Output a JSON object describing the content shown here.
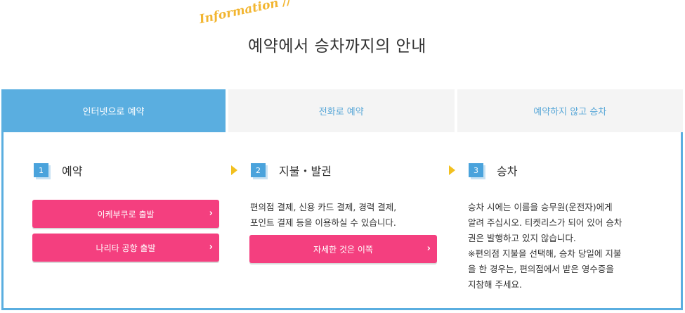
{
  "heading": {
    "decoration": "Information //",
    "title": "예약에서 승차까지의 안내"
  },
  "tabs": [
    {
      "label": "인터넷으로 예약",
      "active": true
    },
    {
      "label": "전화로 예약",
      "active": false
    },
    {
      "label": "예약하지 않고 승차",
      "active": false
    }
  ],
  "steps": [
    {
      "number": "1",
      "title": "예약",
      "buttons": [
        {
          "label": "이케부쿠로 출발",
          "icon": "chevron-right-icon"
        },
        {
          "label": "나리타 공항 출발",
          "icon": "chevron-right-icon"
        }
      ]
    },
    {
      "number": "2",
      "title": "지불・발권",
      "description_lines": [
        "편의점 결제, 신용 카드 결제, 경력 결제,",
        "포인트 결제 등을 이용하실 수 있습니다."
      ],
      "buttons": [
        {
          "label": "자세한 것은 이쪽",
          "icon": "chevron-right-icon"
        }
      ]
    },
    {
      "number": "3",
      "title": "승차",
      "description_lines": [
        "승차 시에는 이름을 승무원(운전자)에게",
        "알려 주십시오. 티켓리스가 되어 있어 승차",
        "권은 발행하고 있지 않습니다.",
        "※편의점 지불을 선택해, 승차 당일에 지불",
        "을 한 경우는, 편의점에서 받은 영수증을",
        "지참해 주세요."
      ]
    }
  ],
  "colors": {
    "accent_blue": "#5aaee0",
    "button_pink": "#f43f7f",
    "arrow_yellow": "#f2c01f",
    "deco_gold": "#f2b530"
  },
  "chevron_glyph": "›"
}
